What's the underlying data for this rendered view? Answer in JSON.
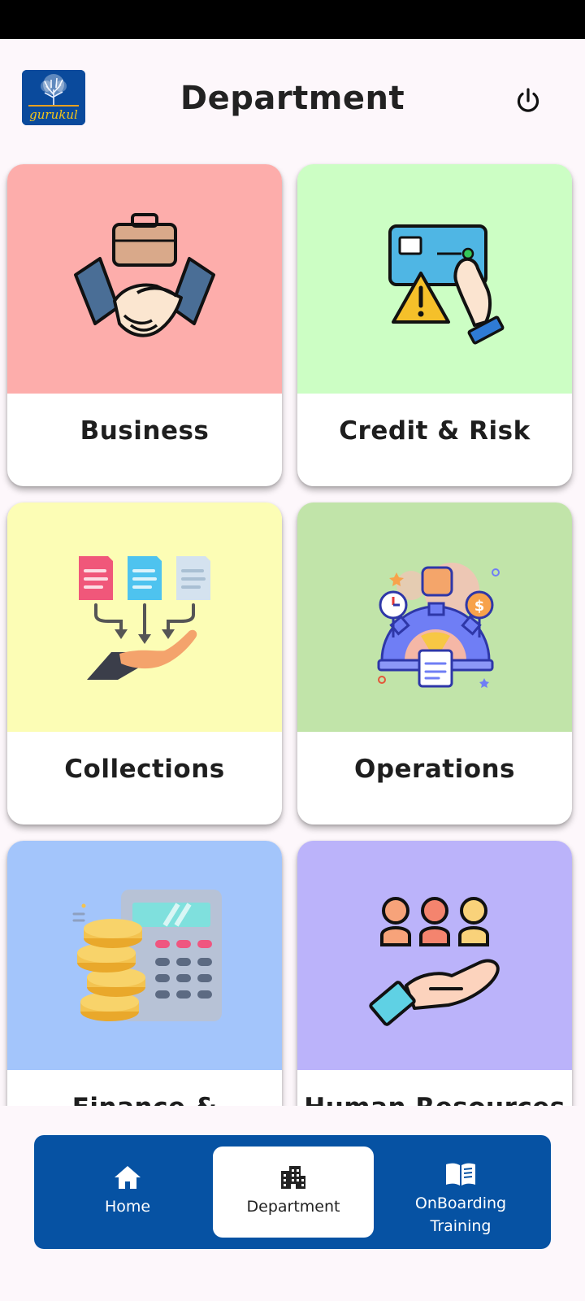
{
  "header": {
    "logo_text": "gurukul",
    "title": "Department",
    "power_icon": "power-icon"
  },
  "departments": [
    {
      "label": "Business",
      "bg": "#fdadab",
      "icon": "handshake-briefcase-icon"
    },
    {
      "label": "Credit & Risk",
      "bg": "#ccfec4",
      "icon": "credit-card-warning-icon"
    },
    {
      "label": "Collections",
      "bg": "#fcfdb5",
      "icon": "documents-to-hand-icon"
    },
    {
      "label": "Operations",
      "bg": "#c1e4a9",
      "icon": "operations-gear-icon"
    },
    {
      "label": "Finance & Accounts",
      "bg": "#a3c5fb",
      "icon": "calculator-coins-icon"
    },
    {
      "label": "Human Resources",
      "bg": "#bbb3fa",
      "icon": "people-hand-icon"
    }
  ],
  "bottom_nav": {
    "items": [
      {
        "label": "Home",
        "icon": "home-icon"
      },
      {
        "label": "Department",
        "icon": "building-icon",
        "selected": true
      },
      {
        "label": "OnBoarding Training",
        "icon": "book-icon"
      }
    ],
    "bg": "#0652a3"
  }
}
